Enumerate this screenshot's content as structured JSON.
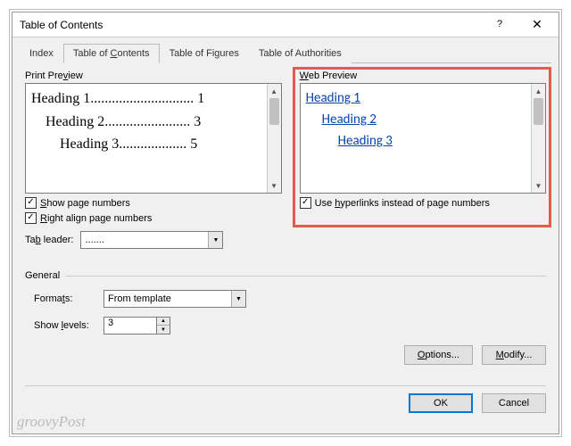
{
  "dialog": {
    "title": "Table of Contents",
    "close_label": "✕",
    "help_label": "?"
  },
  "tabs": {
    "index": "Index",
    "toc_pre": "Table of ",
    "toc_u": "C",
    "toc_post": "ontents",
    "figures": "Table of Figures",
    "authorities": "Table of Authorities"
  },
  "print": {
    "label_pre": "Print Pre",
    "label_u": "v",
    "label_post": "iew",
    "lines": [
      {
        "indent": 0,
        "text": "Heading 1",
        "page": "1"
      },
      {
        "indent": 1,
        "text": "Heading 2",
        "page": "3"
      },
      {
        "indent": 2,
        "text": "Heading 3",
        "page": "5"
      }
    ]
  },
  "web": {
    "label_u": "W",
    "label_post": "eb Preview",
    "lines": [
      {
        "indent": 0,
        "text": "Heading 1"
      },
      {
        "indent": 1,
        "text": "Heading 2"
      },
      {
        "indent": 2,
        "text": "Heading 3"
      }
    ]
  },
  "checks": {
    "show_pages_u": "S",
    "show_pages_post": "how page numbers",
    "right_align_u": "R",
    "right_align_post": "ight align page numbers",
    "hyperlinks_pre": "Use ",
    "hyperlinks_u": "h",
    "hyperlinks_post": "yperlinks instead of page numbers"
  },
  "leader": {
    "label_pre": "Ta",
    "label_u": "b",
    "label_post": " leader:",
    "value": "......."
  },
  "general": {
    "label": "General",
    "formats_pre": "Forma",
    "formats_u": "t",
    "formats_post": "s:",
    "formats_value": "From template",
    "levels_pre": "Show ",
    "levels_u": "l",
    "levels_post": "evels:",
    "levels_value": "3"
  },
  "buttons": {
    "options_u": "O",
    "options_post": "ptions...",
    "modify_u": "M",
    "modify_post": "odify...",
    "ok": "OK",
    "cancel": "Cancel"
  },
  "watermark": "groovyPost"
}
